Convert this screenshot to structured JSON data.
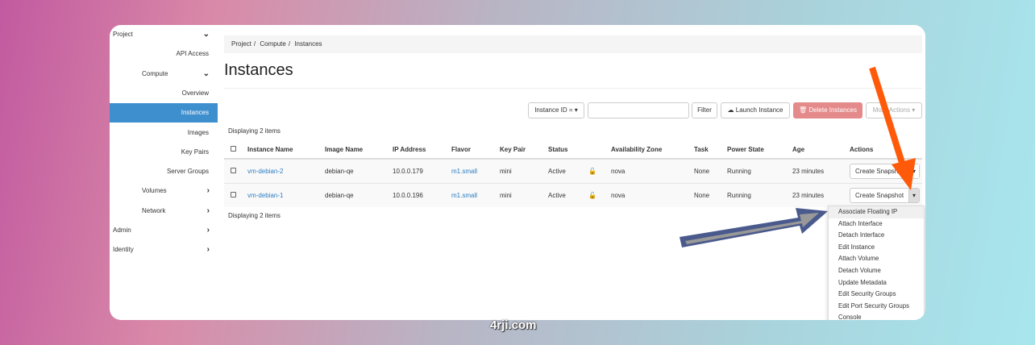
{
  "sidebar": {
    "items": [
      {
        "label": "Project",
        "level": 0,
        "chevron": "down"
      },
      {
        "label": "API Access",
        "level": 2
      },
      {
        "label": "Compute",
        "level": 1,
        "chevron": "down"
      },
      {
        "label": "Overview",
        "level": 2
      },
      {
        "label": "Instances",
        "level": 2,
        "active": true
      },
      {
        "label": "Images",
        "level": 2
      },
      {
        "label": "Key Pairs",
        "level": 2
      },
      {
        "label": "Server Groups",
        "level": 2
      },
      {
        "label": "Volumes",
        "level": 1,
        "chevron": "right"
      },
      {
        "label": "Network",
        "level": 1,
        "chevron": "right"
      },
      {
        "label": "Admin",
        "level": 0,
        "chevron": "right"
      },
      {
        "label": "Identity",
        "level": 0,
        "chevron": "right"
      }
    ]
  },
  "breadcrumb": [
    "Project",
    "Compute",
    "Instances"
  ],
  "page_title": "Instances",
  "toolbar": {
    "filter_select": "Instance ID = ▾",
    "filter_input": "",
    "filter_button": "Filter",
    "launch": "Launch Instance",
    "delete": "Delete Instances",
    "more": "More Actions ▾"
  },
  "display_count": "Displaying 2 items",
  "table": {
    "headers": [
      "Instance Name",
      "Image Name",
      "IP Address",
      "Flavor",
      "Key Pair",
      "Status",
      "",
      "Availability Zone",
      "Task",
      "Power State",
      "Age",
      "Actions"
    ],
    "rows": [
      [
        "vm-debian-2",
        "debian-qe",
        "10.0.0.179",
        "m1.small",
        "mini",
        "Active",
        "",
        "nova",
        "None",
        "Running",
        "23 minutes",
        "Create Snapshot"
      ],
      [
        "vm-debian-1",
        "debian-qe",
        "10.0.0.196",
        "m1.small",
        "mini",
        "Active",
        "",
        "nova",
        "None",
        "Running",
        "23 minutes",
        "Create Snapshot"
      ]
    ]
  },
  "actions_menu": [
    "Associate Floating IP",
    "Attach Interface",
    "Detach Interface",
    "Edit Instance",
    "Attach Volume",
    "Detach Volume",
    "Update Metadata",
    "Edit Security Groups",
    "Edit Port Security Groups",
    "Console"
  ],
  "watermark": "4rji.com",
  "colors": {
    "accent": "#3e8fce",
    "danger": "#e58a8a",
    "arrow_orange": "#ff5a0a",
    "arrow_blue": "#4a5a8c"
  }
}
